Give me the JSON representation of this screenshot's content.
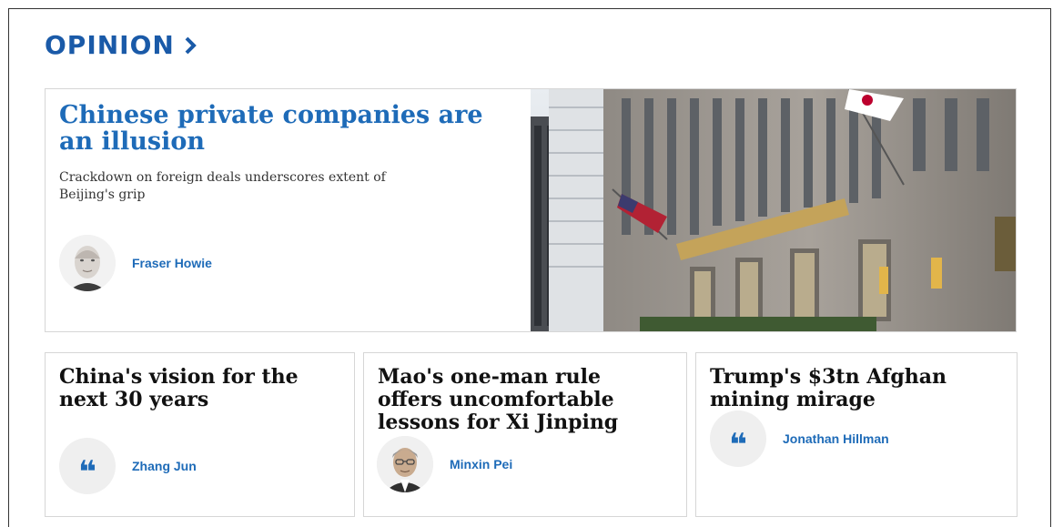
{
  "section": {
    "title": "OPINION",
    "chevron": "chevron-right-icon"
  },
  "featured": {
    "headline": "Chinese private companies are an illusion",
    "standfirst": "Crackdown on foreign deals underscores extent of Beijing's grip",
    "author": "Fraser Howie",
    "image": "hotel-building-photo"
  },
  "articles": [
    {
      "headline": "China's vision for the next 30 years",
      "author": "Zhang Jun",
      "avatar": "quote-icon"
    },
    {
      "headline": "Mao's one-man rule offers uncomfortable lessons for Xi Jinping",
      "author": "Minxin Pei",
      "avatar": "author-photo"
    },
    {
      "headline": "Trump's $3tn Afghan mining mirage",
      "author": "Jonathan Hillman",
      "avatar": "quote-icon"
    }
  ],
  "colors": {
    "accent": "#1e6bb8",
    "title": "#1a5aa8",
    "border": "#d6d6d6"
  }
}
